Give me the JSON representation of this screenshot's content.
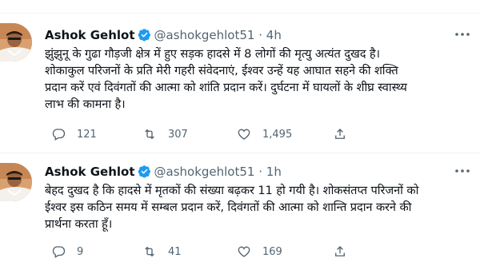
{
  "colors": {
    "text": "#0f1419",
    "muted": "#536471",
    "verified": "#1d9bf0",
    "divider": "#eff3f4"
  },
  "tweets": [
    {
      "name": "Ashok Gehlot",
      "handle": "@ashokgehlot51",
      "separator": "·",
      "time": "4h",
      "lines": [
        "झुंझुनू के गुढा गौड़जी क्षेत्र में हुए सड़क हादसे में 8 लोगों की मृत्यु अत्यंत दुखद है।",
        "शोकाकुल परिजनों के प्रति मेरी गहरी संवेदनाएं, ईश्वर उन्हें यह आघात सहने की शक्ति",
        "प्रदान करें एवं दिवंगतों की आत्मा को शांति प्रदान करें। दुर्घटना में घायलों के शीघ्र स्वास्थ्य",
        "लाभ की कामना है।"
      ],
      "replies": "121",
      "retweets": "307",
      "likes": "1,495"
    },
    {
      "name": "Ashok Gehlot",
      "handle": "@ashokgehlot51",
      "separator": "·",
      "time": "1h",
      "lines": [
        "बेहद दुखद है कि हादसे में मृतकों की संख्या बढ़कर 11 हो गयी है। शोकसंतप्त परिजनों को",
        "ईश्वर इस कठिन समय में सम्बल प्रदान करें, दिवंगतों की आत्मा को शान्ति प्रदान करने की",
        "प्रार्थना करता हूँ।"
      ],
      "replies": "9",
      "retweets": "41",
      "likes": "169"
    }
  ],
  "icons": {
    "avatar": "profile-photo",
    "verified": "verified-badge-icon",
    "more": "more-icon",
    "reply": "reply-icon",
    "retweet": "retweet-icon",
    "like": "heart-icon",
    "share": "share-icon"
  }
}
